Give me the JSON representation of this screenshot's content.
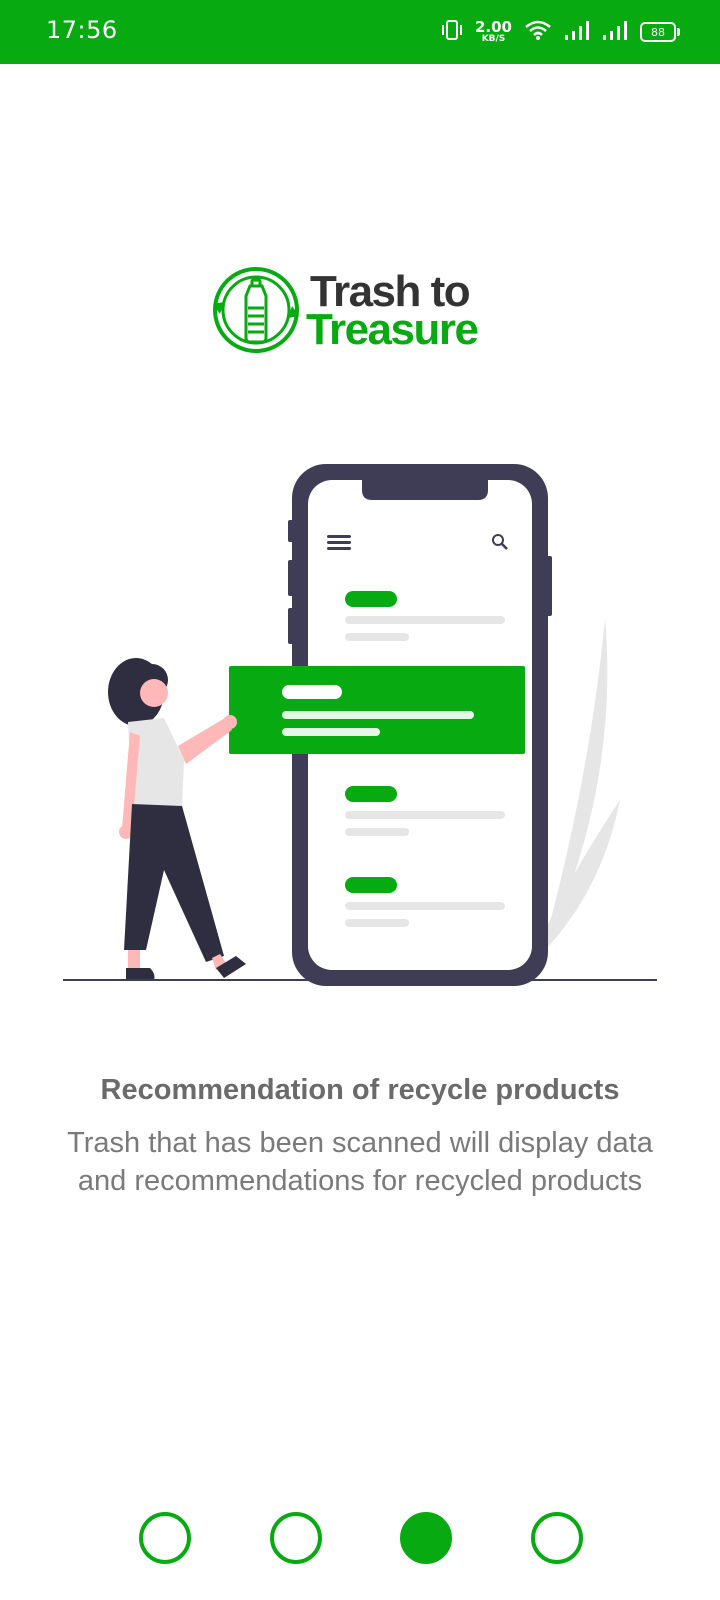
{
  "status_bar": {
    "time": "17:56",
    "net_speed_value": "2.00",
    "net_speed_unit": "KB/S",
    "battery_level": "88",
    "icons": [
      "vibrate-icon",
      "wifi-icon",
      "signal-icon",
      "signal-icon",
      "battery-icon"
    ]
  },
  "logo": {
    "line1": "Trash to",
    "line2": "Treasure"
  },
  "onboarding": {
    "headline": "Recommendation of recycle products",
    "description": "Trash that has been scanned will display data and recommendations for recycled products"
  },
  "pager": {
    "total": 4,
    "active_index": 2
  },
  "colors": {
    "brand_green": "#07aa11",
    "phone_frame": "#3f3d56",
    "text_gray": "#6a6a6a"
  }
}
